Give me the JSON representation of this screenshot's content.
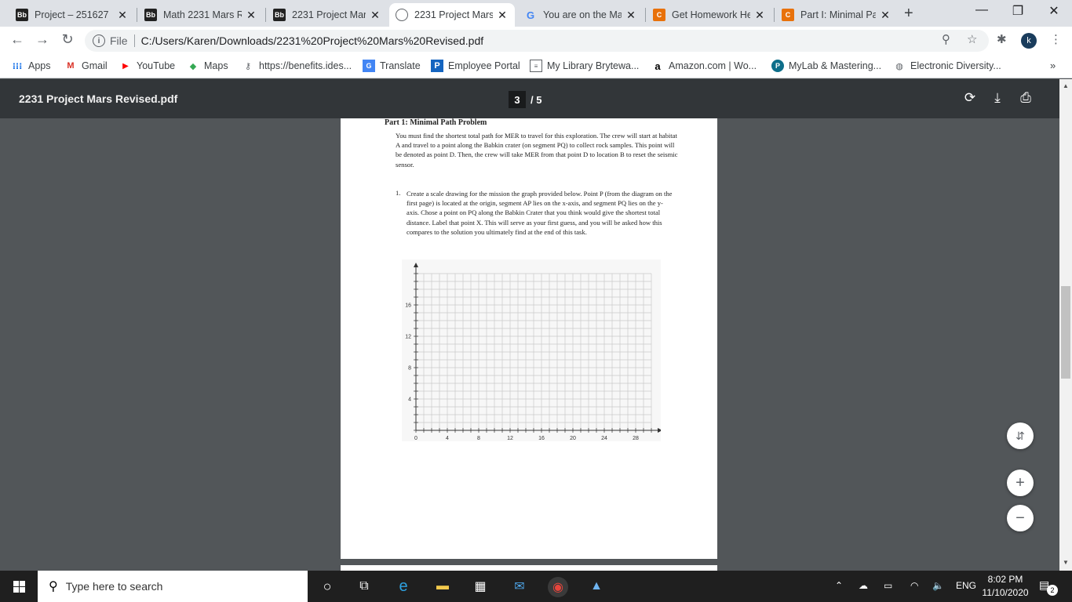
{
  "tabs": [
    {
      "title": "Project – 251627",
      "favicon": "Bb"
    },
    {
      "title": "Math 2231 Mars R",
      "favicon": "Bb"
    },
    {
      "title": "2231 Project Mars",
      "favicon": "Bb"
    },
    {
      "title": "2231 Project Mars",
      "favicon": "chrome-icon",
      "active": true
    },
    {
      "title": "You are on the Ma",
      "favicon": "G"
    },
    {
      "title": "Get Homework He",
      "favicon": "C"
    },
    {
      "title": "Part I: Minimal Pat",
      "favicon": "C"
    }
  ],
  "omnibox": {
    "scheme_label": "File",
    "url": "C:/Users/Karen/Downloads/2231%20Project%20Mars%20Revised.pdf"
  },
  "profile_initial": "k",
  "bookmarks": [
    {
      "label": "Apps"
    },
    {
      "label": "Gmail"
    },
    {
      "label": "YouTube"
    },
    {
      "label": "Maps"
    },
    {
      "label": "https://benefits.ides..."
    },
    {
      "label": "Translate"
    },
    {
      "label": "Employee Portal"
    },
    {
      "label": "My Library Brytewa..."
    },
    {
      "label": "Amazon.com | Wo..."
    },
    {
      "label": "MyLab & Mastering..."
    },
    {
      "label": "Electronic Diversity..."
    }
  ],
  "pdf": {
    "doc_name": "2231 Project Mars Revised.pdf",
    "current_page": "3",
    "total_pages": "/ 5"
  },
  "document": {
    "heading": "Part 1: Minimal Path Problem",
    "paragraph": "You must find the shortest total path for MER to travel for this exploration. The crew will start at habitat A and travel to a point along the Babkin crater (on segment PQ) to collect rock samples. This point will be denoted as point D. Then, the crew will take MER from that point D to location B to reset the seismic sensor.",
    "question_number": "1.",
    "question": "Create a scale drawing for the mission the graph provided below. Point P (from the diagram on the first page) is located at the origin, segment AP lies on the x-axis, and segment PQ lies on the y-axis. Chose a point on PQ along the Babkin Crater that you think would give the shortest total distance. Label that point X. This will serve as your first guess, and you will be asked how this compares to the solution you ultimately find at the end of this task."
  },
  "chart_data": {
    "type": "scatter",
    "title": "",
    "xlabel": "",
    "ylabel": "",
    "x_ticks": [
      "0",
      "4",
      "8",
      "12",
      "16",
      "20",
      "24",
      "28"
    ],
    "y_ticks": [
      "4",
      "8",
      "12",
      "16"
    ],
    "xlim": [
      0,
      30
    ],
    "ylim": [
      0,
      20
    ],
    "grid": true,
    "grid_step": 1,
    "series": []
  },
  "taskbar": {
    "search_placeholder": "Type here to search",
    "language": "ENG",
    "time": "8:02 PM",
    "date": "11/10/2020",
    "notification_count": "2"
  }
}
